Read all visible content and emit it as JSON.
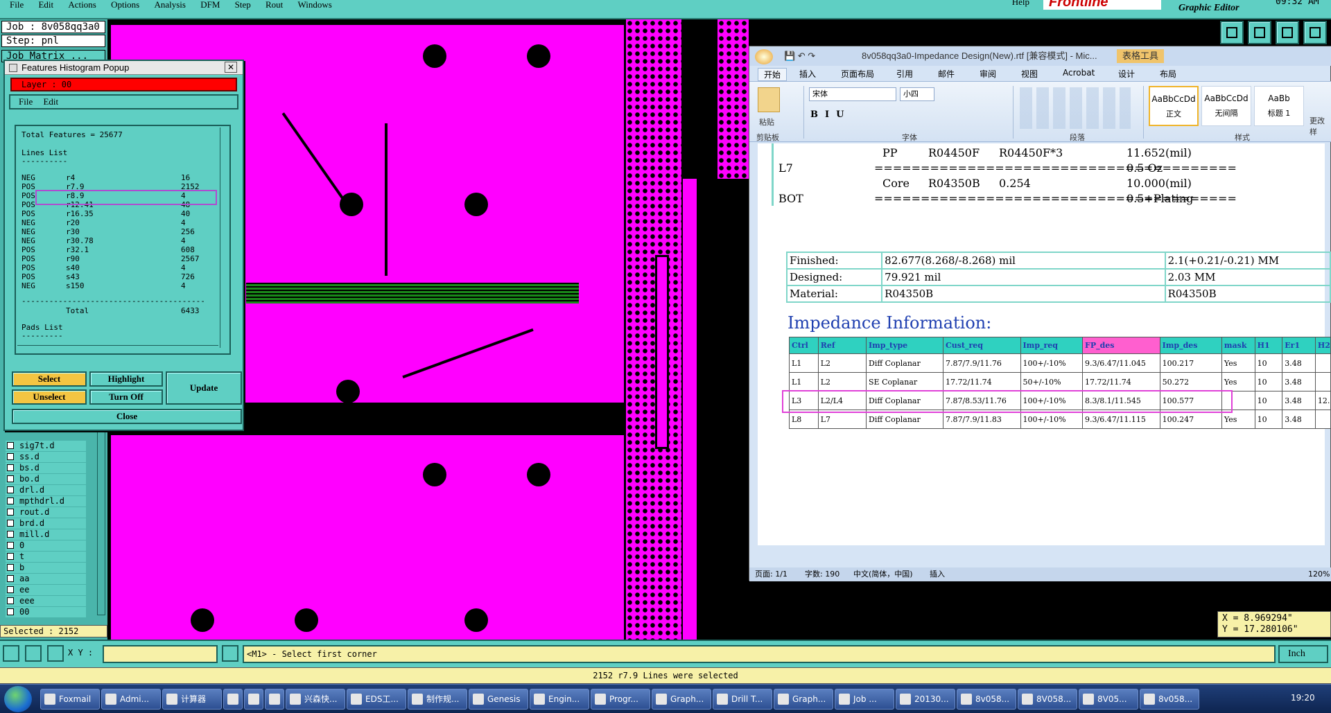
{
  "menubar": {
    "items": [
      "File",
      "Edit",
      "Actions",
      "Options",
      "Analysis",
      "DFM",
      "Step",
      "Rout",
      "Windows"
    ],
    "help": "Help",
    "logo": "Frontline",
    "graphic_editor": "Graphic Editor",
    "time": "09:32 AM"
  },
  "left": {
    "job": "Job : 8v058qq3a0",
    "step": "Step: pnl",
    "job_matrix": "Job Matrix ...",
    "layers": [
      "sig7t.d",
      "ss.d",
      "bs.d",
      "bo.d",
      "drl.d",
      "mpthdrl.d",
      "rout.d",
      "brd.d",
      "mill.d",
      "0",
      "t",
      "b",
      "aa",
      "ee",
      "eee",
      "00"
    ],
    "selected": "Selected : 2152"
  },
  "popup": {
    "title": "Features Histogram Popup",
    "layer_label": "Layer :  00",
    "menu_file": "File",
    "menu_edit": "Edit",
    "total": "Total Features = 25677",
    "lines_list": "Lines List",
    "dashes": "----------",
    "rows": [
      [
        "NEG",
        "r4",
        "16"
      ],
      [
        "POS",
        "r7.9",
        "2152"
      ],
      [
        "POS",
        "r8.9",
        "4"
      ],
      [
        "POS",
        "r12.41",
        "48"
      ],
      [
        "POS",
        "r16.35",
        "40"
      ],
      [
        "NEG",
        "r20",
        "4"
      ],
      [
        "NEG",
        "r30",
        "256"
      ],
      [
        "NEG",
        "r30.78",
        "4"
      ],
      [
        "POS",
        "r32.1",
        "608"
      ],
      [
        "POS",
        "r90",
        "2567"
      ],
      [
        "POS",
        "s40",
        "4"
      ],
      [
        "POS",
        "s43",
        "726"
      ],
      [
        "NEG",
        "s150",
        "4"
      ]
    ],
    "sep": "----------------------------------------",
    "total_label": "Total",
    "total_value": "6433",
    "pads_list": "Pads List",
    "pads_dashes": "---------",
    "btn_select": "Select",
    "btn_highlight": "Highlight",
    "btn_unselect": "Unselect",
    "btn_turnoff": "Turn Off",
    "btn_update": "Update",
    "btn_close": "Close"
  },
  "word": {
    "title": "8v058qq3a0-Impedance Design(New).rtf [兼容模式] - Mic...",
    "table_tools": "表格工具",
    "tabs": [
      "开始",
      "插入",
      "页面布局",
      "引用",
      "邮件",
      "审阅",
      "视图",
      "Acrobat",
      "设计",
      "布局"
    ],
    "font": "宋体",
    "size": "小四",
    "paste": "粘贴",
    "groups": [
      "剪贴板",
      "字体",
      "段落",
      "样式"
    ],
    "styles": [
      {
        "sample": "AaBbCcDd",
        "name": "正文"
      },
      {
        "sample": "AaBbCcDd",
        "name": "无间隔"
      },
      {
        "sample": "AaBb",
        "name": "标题 1"
      }
    ],
    "change_style": "更改样",
    "stack": [
      {
        "a": "PP",
        "b": "R04450F",
        "c": "R04450F*3",
        "d": "11.652(mil)"
      },
      {
        "label": "L7",
        "line": "=======================================",
        "d": "0.5 Oz"
      },
      {
        "a": "Core",
        "b": "R04350B",
        "c": "0.254",
        "d": "10.000(mil)"
      },
      {
        "label": "BOT",
        "line": "=======================================",
        "d": "0.5+Plating"
      }
    ],
    "spec": [
      [
        "Finished:",
        "82.677(8.268/-8.268) mil",
        "2.1(+0.21/-0.21) MM"
      ],
      [
        "Designed:",
        "79.921 mil",
        "2.03 MM"
      ],
      [
        "Material:",
        "R04350B",
        "R04350B"
      ]
    ],
    "imp_heading": "Impedance Information:",
    "imp_headers": [
      "Ctrl",
      "Ref",
      "Imp_type",
      "Cust_req",
      "Imp_req",
      "FP_des",
      "Imp_des",
      "mask",
      "H1",
      "Er1",
      "H2"
    ],
    "imp_rows": [
      [
        "L1",
        "L2",
        "Diff Coplanar",
        "7.87/7.9/11.76",
        "100+/-10%",
        "9.3/6.47/11.045",
        "100.217",
        "Yes",
        "10",
        "3.48",
        ""
      ],
      [
        "L1",
        "L2",
        "SE Coplanar",
        "17.72/11.74",
        "50+/-10%",
        "17.72/11.74",
        "50.272",
        "Yes",
        "10",
        "3.48",
        ""
      ],
      [
        "L3",
        "L2/L4",
        "Diff Coplanar",
        "7.87/8.53/11.76",
        "100+/-10%",
        "8.3/8.1/11.545",
        "100.577",
        "",
        "10",
        "3.48",
        "12."
      ],
      [
        "L8",
        "L7",
        "Diff Coplanar",
        "7.87/7.9/11.83",
        "100+/-10%",
        "9.3/6.47/11.115",
        "100.247",
        "Yes",
        "10",
        "3.48",
        ""
      ]
    ],
    "status": {
      "page": "页面: 1/1",
      "words": "字数: 190",
      "lang": "中文(简体，中国)",
      "mode": "插入",
      "zoom": "120%"
    }
  },
  "coords": {
    "x": "X = 8.969294\"",
    "y": "Y = 17.280106\""
  },
  "cmd": {
    "xy_label": "X Y :",
    "prompt": "<M1> - Select first corner",
    "unit": "Inch",
    "message": "2152 r7.9 Lines were selected"
  },
  "taskbar": {
    "items": [
      "Foxmail",
      "Admi...",
      "计算器",
      "",
      "",
      "",
      "兴森快...",
      "EDS工...",
      "制作规...",
      "Genesis",
      "Engin...",
      "Progr...",
      "Graph...",
      "Drill T...",
      "Graph...",
      "Job ...",
      "20130...",
      "8v058...",
      "8V058...",
      "8V05...",
      "8v058..."
    ],
    "time": "19:20"
  },
  "colors": {
    "teal": "#5fcfc3",
    "magenta": "#ff00ff",
    "highlight": "#b04ad0",
    "yellow": "#f7f1a8"
  }
}
